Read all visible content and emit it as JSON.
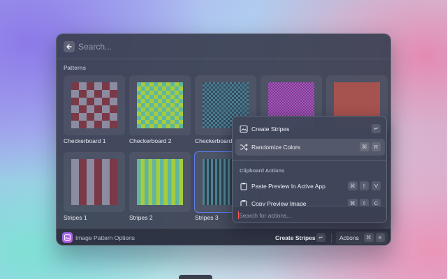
{
  "search": {
    "placeholder": "Search..."
  },
  "section_title": "Patterns",
  "tiles": [
    {
      "label": "Checkerboard 1",
      "pattern": "checkerboard",
      "colors": [
        "#7a3947",
        "#8d8ba0"
      ]
    },
    {
      "label": "Checkerboard 2",
      "pattern": "checkerboard",
      "colors": [
        "#5fb6a0",
        "#a6cc3e"
      ]
    },
    {
      "label": "Checkerboard",
      "pattern": "checkerboard-small",
      "colors": [
        "#344b5f",
        "#4c7e91"
      ]
    },
    {
      "label": "",
      "pattern": "checkerboard-small",
      "colors": [
        "#7a3c92",
        "#a856b9"
      ]
    },
    {
      "label": "",
      "pattern": "solid",
      "colors": [
        "#a6524e",
        "#a6524e"
      ]
    },
    {
      "label": "Stripes 1",
      "pattern": "stripes",
      "colors": [
        "#8d8ba0",
        "#7a3947"
      ]
    },
    {
      "label": "Stripes 2",
      "pattern": "stripes",
      "colors": [
        "#5fb6a0",
        "#a6cc3e"
      ]
    },
    {
      "label": "Stripes 3",
      "pattern": "stripes-thin",
      "colors": [
        "#2d3e4c",
        "#4f8191"
      ]
    }
  ],
  "footer": {
    "title": "Image Pattern Options",
    "primary_action": "Create Stripes",
    "primary_key": "↵",
    "actions_label": "Actions",
    "actions_keys": [
      "⌘",
      "K"
    ]
  },
  "menu": {
    "items": [
      {
        "label": "Create Stripes",
        "icon": "image-icon",
        "keys": [
          "↵"
        ]
      },
      {
        "label": "Randomize Colors",
        "icon": "shuffle-icon",
        "keys": [
          "⌘",
          "R"
        ]
      }
    ],
    "section": "Clipboard Actions",
    "clipboard_items": [
      {
        "label": "Paste Preview In Active App",
        "icon": "clipboard-icon",
        "keys": [
          "⌘",
          "⇧",
          "V"
        ]
      },
      {
        "label": "Copy Preview Image",
        "icon": "clipboard-icon",
        "keys": [
          "⌘",
          "⇧",
          "C"
        ]
      }
    ],
    "search_placeholder": "Search for actions..."
  },
  "accent_color": "#5f7cf0"
}
